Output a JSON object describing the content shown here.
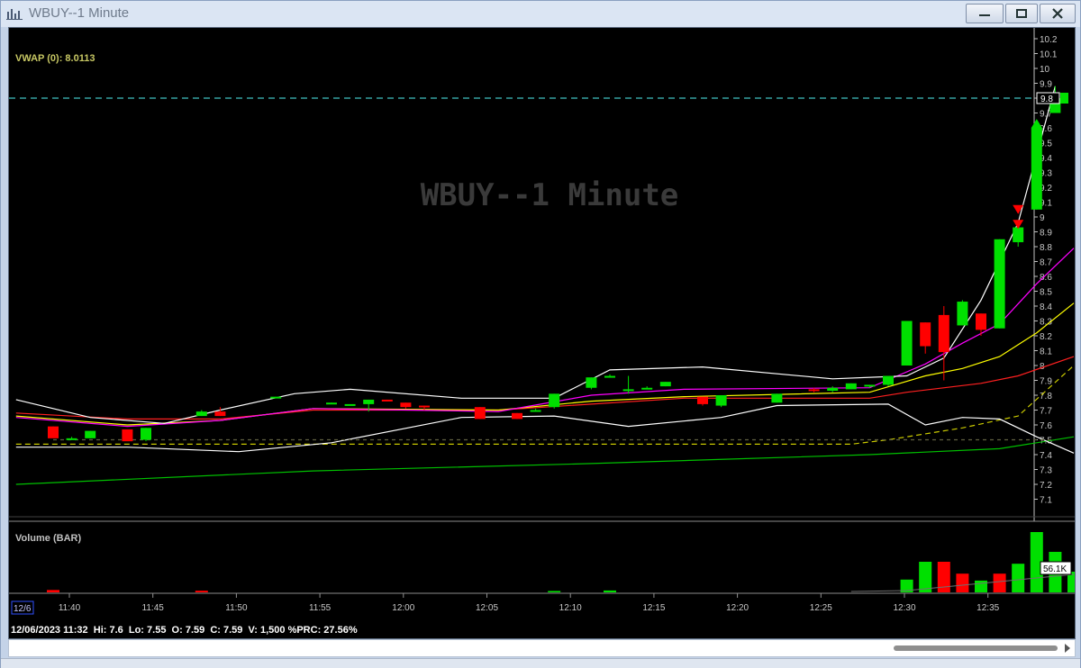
{
  "window": {
    "title": "WBUY--1 Minute",
    "controls": {
      "minimize": "minimize",
      "maximize": "maximize",
      "close": "close"
    }
  },
  "chart": {
    "watermark": "WBUY--1 Minute",
    "vwap_label": "VWAP (0): 8.0113",
    "price_tag": "9.8",
    "volume_label": "Volume (BAR)",
    "volume_tag": "56.1K",
    "date_tag": "12/6",
    "info_line": "12/06/2023 11:32  Hi: 7.6  Lo: 7.55  O: 7.59  C: 7.59  V: 1,500 %PRC: 27.56%",
    "colors": {
      "up": "#00e000",
      "down": "#ff0000",
      "vwap": "#c8c800",
      "bollinger": "#ffffff",
      "ema_fast": "#ff00ff",
      "ema_mid": "#ffff00",
      "ema_slow": "#ff2020",
      "long_ma": "#00c000",
      "resistance": "#40c0c0"
    }
  },
  "chart_data": {
    "type": "candlestick",
    "title": "WBUY--1 Minute",
    "price_axis": {
      "ticks": [
        "10.2",
        "10.1",
        "10",
        "9.9",
        "9.8",
        "9.7",
        "9.6",
        "9.5",
        "9.4",
        "9.3",
        "9.2",
        "9.1",
        "9",
        "8.9",
        "8.8",
        "8.7",
        "8.6",
        "8.5",
        "8.4",
        "8.3",
        "8.2",
        "8.1",
        "8",
        "7.9",
        "7.8",
        "7.7",
        "7.6",
        "7.5",
        "7.4",
        "7.3",
        "7.2",
        "7.1"
      ],
      "range": [
        7.05,
        10.25
      ],
      "last_price": 9.8
    },
    "time_axis": {
      "ticks": [
        "11:40",
        "11:45",
        "11:50",
        "11:55",
        "12:00",
        "12:05",
        "12:10",
        "12:15",
        "12:20",
        "12:25",
        "12:30",
        "12:35"
      ]
    },
    "minutes_from_first": [
      [
        1,
        7.59,
        7.59,
        7.55,
        7.51
      ],
      [
        2,
        7.51,
        7.52,
        7.5,
        7.51
      ],
      [
        3,
        7.51,
        7.56,
        7.51,
        7.56
      ],
      [
        5,
        7.57,
        7.57,
        7.5,
        7.49
      ],
      [
        6,
        7.5,
        7.58,
        7.49,
        7.58
      ],
      [
        9,
        7.66,
        7.7,
        7.66,
        7.69
      ],
      [
        10,
        7.69,
        7.72,
        7.66,
        7.66
      ],
      [
        13,
        7.78,
        7.79,
        7.78,
        7.79
      ],
      [
        16,
        7.74,
        7.75,
        7.74,
        7.75
      ],
      [
        17,
        7.74,
        7.74,
        7.74,
        7.74
      ],
      [
        18,
        7.74,
        7.77,
        7.69,
        7.77
      ],
      [
        19,
        7.77,
        7.77,
        7.76,
        7.76
      ],
      [
        20,
        7.75,
        7.75,
        7.71,
        7.72
      ],
      [
        21,
        7.73,
        7.73,
        7.7,
        7.72
      ],
      [
        24,
        7.72,
        7.72,
        7.64,
        7.64
      ],
      [
        26,
        7.68,
        7.68,
        7.64,
        7.64
      ],
      [
        27,
        7.69,
        7.71,
        7.69,
        7.7
      ],
      [
        28,
        7.72,
        7.81,
        7.71,
        7.81
      ],
      [
        30,
        7.85,
        7.92,
        7.84,
        7.92
      ],
      [
        31,
        7.93,
        7.94,
        7.93,
        7.93
      ],
      [
        32,
        7.83,
        7.93,
        7.81,
        7.84
      ],
      [
        33,
        7.85,
        7.86,
        7.84,
        7.85
      ],
      [
        34,
        7.86,
        7.89,
        7.86,
        7.89
      ],
      [
        36,
        7.79,
        7.79,
        7.73,
        7.74
      ],
      [
        37,
        7.73,
        7.8,
        7.72,
        7.8
      ],
      [
        40,
        7.75,
        7.81,
        7.75,
        7.81
      ],
      [
        42,
        7.84,
        7.85,
        7.82,
        7.83
      ],
      [
        43,
        7.83,
        7.86,
        7.82,
        7.85
      ],
      [
        44,
        7.84,
        7.88,
        7.84,
        7.88
      ],
      [
        45,
        7.86,
        7.87,
        7.85,
        7.87
      ],
      [
        46,
        7.87,
        7.93,
        7.86,
        7.93
      ],
      [
        47,
        8.0,
        8.3,
        8.0,
        8.3
      ],
      [
        48,
        8.29,
        8.29,
        8.08,
        8.13
      ],
      [
        49,
        8.34,
        8.4,
        7.9,
        8.09
      ],
      [
        50,
        8.27,
        8.44,
        8.27,
        8.43
      ],
      [
        51,
        8.35,
        8.35,
        8.2,
        8.24
      ],
      [
        52,
        8.25,
        8.85,
        8.25,
        8.85
      ],
      [
        53,
        8.83,
        8.96,
        8.8,
        8.93
      ],
      [
        54,
        9.05,
        9.6,
        9.05,
        9.6
      ],
      [
        55,
        9.7,
        9.88,
        9.7,
        9.8
      ]
    ],
    "volume_bars_k": [
      [
        1,
        1.5,
        "down"
      ],
      [
        9,
        0.8,
        "down"
      ],
      [
        28,
        0.5,
        "up"
      ],
      [
        31,
        1.0,
        "up"
      ],
      [
        47,
        12,
        "up"
      ],
      [
        48,
        30,
        "up"
      ],
      [
        49,
        30,
        "down"
      ],
      [
        50,
        18,
        "down"
      ],
      [
        51,
        11,
        "up"
      ],
      [
        52,
        18,
        "down"
      ],
      [
        53,
        28,
        "up"
      ],
      [
        54,
        60,
        "up"
      ],
      [
        55,
        40,
        "up"
      ],
      [
        56,
        20,
        "up"
      ]
    ],
    "volume_last": "56.1K",
    "vwap": 8.0113
  }
}
